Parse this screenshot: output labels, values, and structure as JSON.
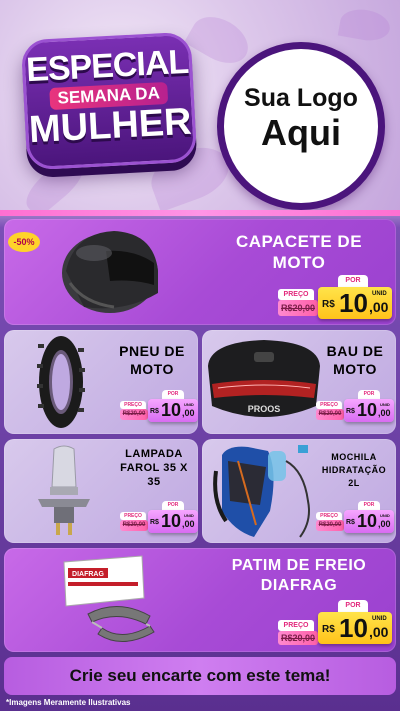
{
  "header": {
    "badge_line1": "ESPECIAL",
    "badge_line2": "SEMANA DA",
    "badge_line3": "MULHER",
    "logo_line1": "Sua Logo",
    "logo_line2": "Aqui"
  },
  "discount_badge": "-50%",
  "products": [
    {
      "title": "CAPACETE DE MOTO",
      "preco_label": "PREÇO",
      "old_price": "R$20,00",
      "por_label": "POR",
      "currency": "R$",
      "price_int": "10",
      "price_cents": ",00",
      "unit": "UNID"
    },
    {
      "title": "PNEU DE MOTO",
      "preco_label": "PREÇO",
      "old_price": "R$20,00",
      "por_label": "POR",
      "currency": "R$",
      "price_int": "10",
      "price_cents": ",00",
      "unit": "UNID"
    },
    {
      "title": "BAU DE MOTO",
      "preco_label": "PREÇO",
      "old_price": "R$20,00",
      "por_label": "POR",
      "currency": "R$",
      "price_int": "10",
      "price_cents": ",00",
      "unit": "UNID"
    },
    {
      "title": "LAMPADA FAROL 35 X 35",
      "preco_label": "PREÇO",
      "old_price": "R$20,00",
      "por_label": "POR",
      "currency": "R$",
      "price_int": "10",
      "price_cents": ",00",
      "unit": "UNID"
    },
    {
      "title": "MOCHILA HIDRATAÇÃO 2L",
      "preco_label": "PREÇO",
      "old_price": "R$20,00",
      "por_label": "POR",
      "currency": "R$",
      "price_int": "10",
      "price_cents": ",00",
      "unit": "UNID"
    },
    {
      "title": "PATIM DE FREIO DIAFRAG",
      "preco_label": "PREÇO",
      "old_price": "R$20,00",
      "por_label": "POR",
      "currency": "R$",
      "price_int": "10",
      "price_cents": ",00",
      "unit": "UNID"
    }
  ],
  "product_images": [
    "helmet-image",
    "tire-image",
    "top-case-image",
    "headlight-bulb-image",
    "hydration-backpack-image",
    "brake-shoe-image"
  ],
  "brand_on_box": "DIAFRAG",
  "brand_on_case": "PROOS",
  "footer_banner": "Crie seu encarte com este tema!",
  "disclaimer": "*Imagens Meramente Ilustrativas",
  "colors": {
    "accent": "#a84bd6",
    "price_yellow": "#ffc21a",
    "pink": "#e2297c",
    "dark_purple": "#4b157c"
  }
}
